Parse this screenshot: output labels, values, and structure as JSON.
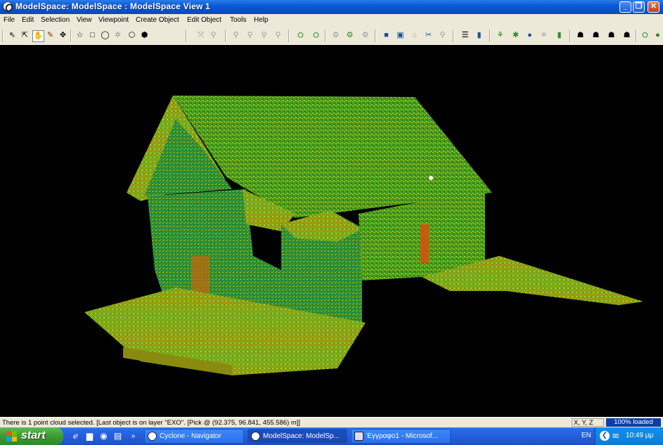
{
  "window": {
    "title": "ModelSpace: ModelSpace  : ModelSpace  View 1",
    "controls": [
      "minimize",
      "maximize",
      "close"
    ]
  },
  "menu": [
    "File",
    "Edit",
    "Selection",
    "View",
    "Viewpoint",
    "Create Object",
    "Edit Object",
    "Tools",
    "Help"
  ],
  "toolbar": {
    "icons": [
      "select-arrow-icon",
      "select-add-icon",
      "pan-hand-icon",
      "pencil-icon",
      "move-cross-icon",
      "polygon-fence-icon",
      "rectangle-fence-icon",
      "circle-fence-icon",
      "star-icon",
      "eraser-icon",
      "cube-icon",
      "fit-icon",
      "zoom-in-icon",
      "zoom-out-icon",
      "zoom-window-icon",
      "zoom-prev-icon",
      "orbit-icon",
      "orbit-2-icon",
      "rotate-icon",
      "rotate-2-icon",
      "rotate-3-icon",
      "layers-icon",
      "copy-icon",
      "paste-icon",
      "measure-icon",
      "search-icon",
      "levels-icon",
      "select-tag-icon",
      "axis-icon",
      "grid-icon",
      "globe-icon",
      "dim-icon",
      "register-icon",
      "camera-a-icon",
      "camera-b-icon",
      "camera-c-icon",
      "camera-d-icon",
      "settings-icon",
      "status-dot-icon"
    ]
  },
  "viewport": {
    "content": "point-cloud-house",
    "background": "#000000",
    "palette": [
      "#2e8b22",
      "#4aa61e",
      "#8cc21a",
      "#c2c418",
      "#d88a10",
      "#1f8a6a"
    ]
  },
  "status": {
    "message": "There is 1 point cloud selected. [Last object is on layer \"EXO\". [Pick @ (92.375, 96.841, 455.586) m]]",
    "coord_mode": "X, Y, Z",
    "loaded": "100% loaded"
  },
  "taskbar": {
    "start_label": "start",
    "quick_launch": [
      "ie-icon",
      "folder-icon",
      "media-icon",
      "desktop-icon"
    ],
    "overflow": "»",
    "tasks": [
      {
        "label": "Cyclone - Navigator",
        "active": false
      },
      {
        "label": "ModelSpace: ModelSp...",
        "active": true
      },
      {
        "label": "Έγγραφο1 - Microsof...",
        "active": false
      }
    ],
    "language": "EN",
    "clock": "10:49 μμ"
  }
}
